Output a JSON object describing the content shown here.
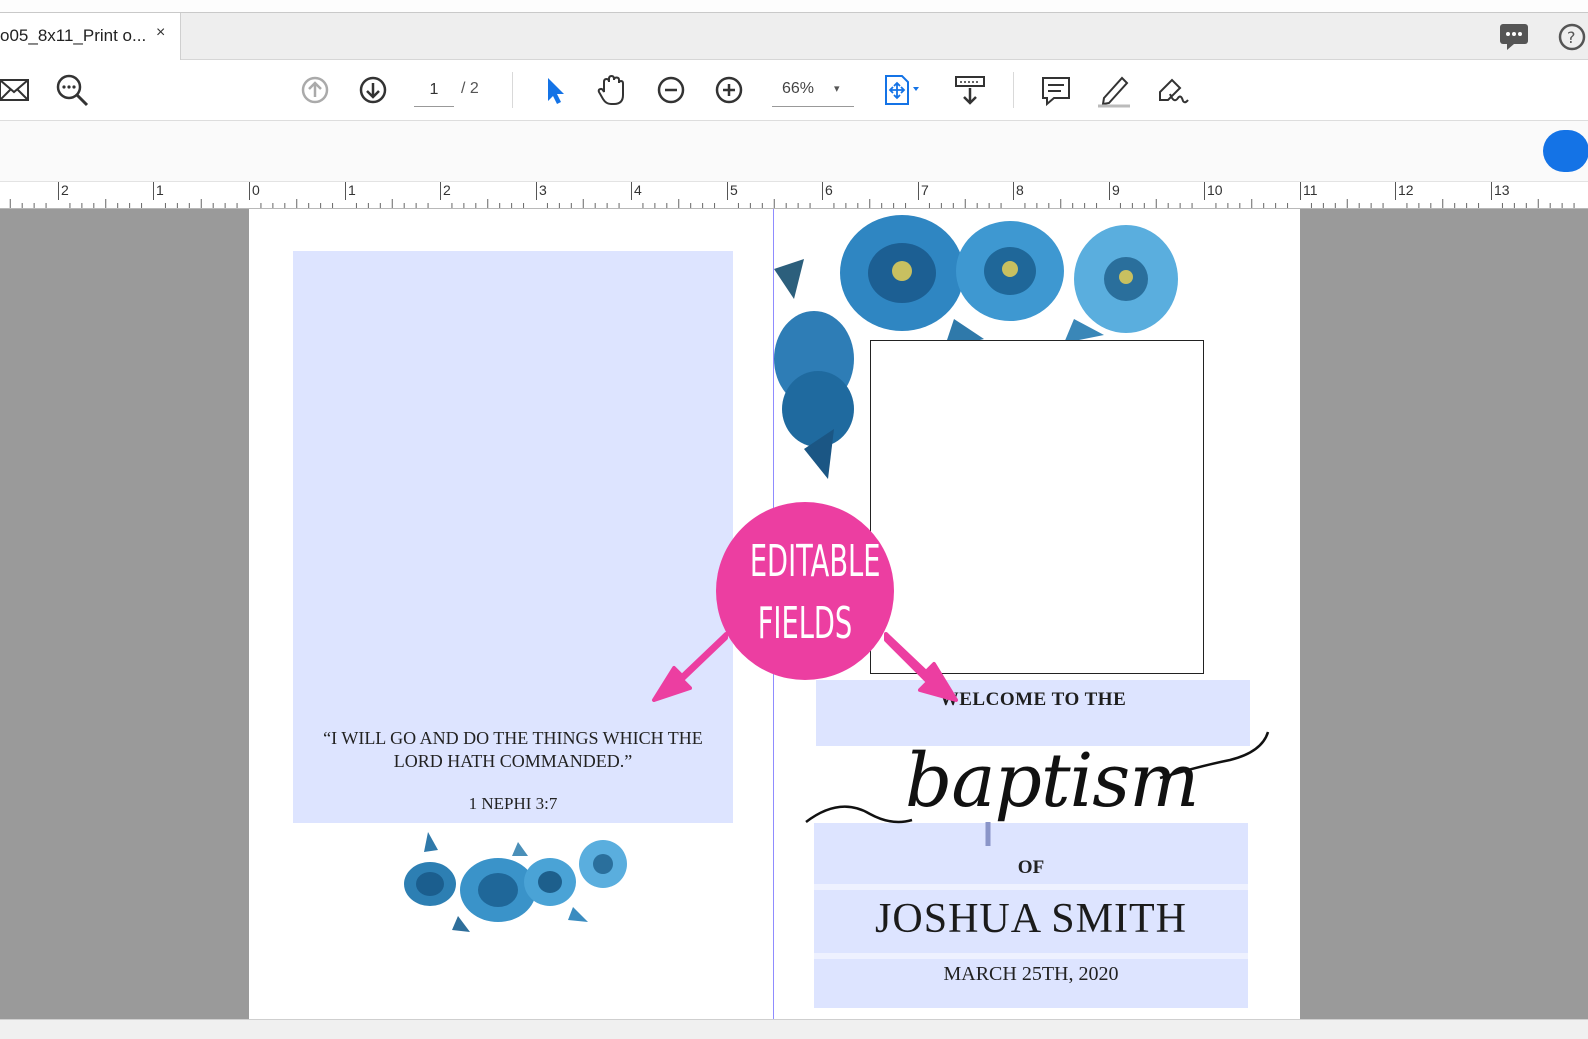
{
  "tab": {
    "title": "o05_8x11_Print o...",
    "close": "×"
  },
  "toolbar": {
    "page_current": "1",
    "page_total": "/ 2",
    "zoom": "66%",
    "zoom_arrow": "▾"
  },
  "ruler": {
    "marks": [
      "2",
      "1",
      "0",
      "1",
      "2",
      "3",
      "4",
      "5",
      "6",
      "7",
      "8",
      "9",
      "10",
      "11",
      "12",
      "13"
    ]
  },
  "left_panel": {
    "quote": "“I WILL GO AND DO THE THINGS WHICH THE LORD HATH COMMANDED.”",
    "verse": "1 NEPHI 3:7"
  },
  "right_panel": {
    "welcome": "WELCOME TO THE",
    "script_word": "baptism",
    "of": "OF",
    "name": "JOSHUA SMITH",
    "date": "MARCH 25TH, 2020"
  },
  "overlay": {
    "line1": "EDITABLE",
    "line2": "FIELDS"
  },
  "colors": {
    "field_fill": "#dde4ff",
    "badge": "#ec3ea1",
    "accent_blue": "#1473e6",
    "workspace": "#9a9a9a"
  },
  "icons": [
    "mail-icon",
    "zoom-search-icon",
    "page-up-icon",
    "page-down-icon",
    "select-cursor-icon",
    "hand-icon",
    "zoom-out-icon",
    "zoom-in-icon",
    "fit-page-icon",
    "scroll-mode-icon",
    "comment-icon",
    "highlight-pen-icon",
    "sign-icon",
    "chat-icon",
    "help-icon"
  ]
}
